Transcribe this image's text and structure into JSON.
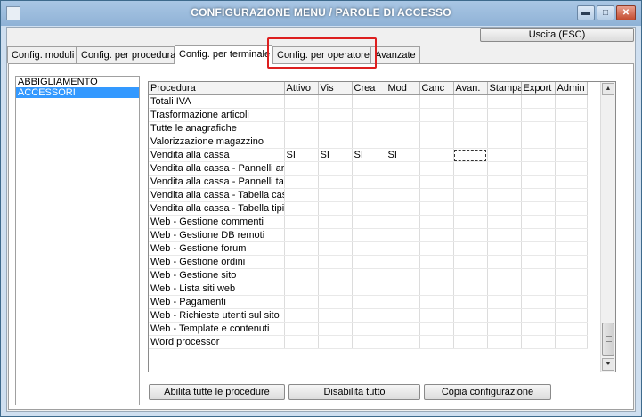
{
  "window": {
    "title": "CONFIGURAZIONE MENU / PAROLE DI ACCESSO",
    "minimize": "▬",
    "maximize": "□",
    "close": "✕"
  },
  "toolbar": {
    "exit_label": "Uscita (ESC)"
  },
  "tabs": [
    {
      "label": "Config. moduli"
    },
    {
      "label": "Config. per procedura"
    },
    {
      "label": "Config. per terminale"
    },
    {
      "label": "Config. per operatore"
    },
    {
      "label": "Avanzate"
    }
  ],
  "left_list": {
    "items": [
      "ABBIGLIAMENTO",
      "ACCESSORI"
    ],
    "selected_index": 1
  },
  "grid": {
    "columns": [
      "Procedura",
      "Attivo",
      "Vis",
      "Crea",
      "Mod",
      "Canc",
      "Avan.",
      "Stampa",
      "Export",
      "Admin"
    ],
    "rows": [
      [
        "Totali IVA",
        "",
        "",
        "",
        "",
        "",
        "",
        "",
        "",
        ""
      ],
      [
        "Trasformazione articoli",
        "",
        "",
        "",
        "",
        "",
        "",
        "",
        "",
        ""
      ],
      [
        "Tutte le anagrafiche",
        "",
        "",
        "",
        "",
        "",
        "",
        "",
        "",
        ""
      ],
      [
        "Valorizzazione magazzino",
        "",
        "",
        "",
        "",
        "",
        "",
        "",
        "",
        ""
      ],
      [
        "Vendita alla cassa",
        "SI",
        "SI",
        "SI",
        "SI",
        "",
        "",
        "",
        "",
        ""
      ],
      [
        "Vendita alla cassa - Pannelli artico",
        "",
        "",
        "",
        "",
        "",
        "",
        "",
        "",
        ""
      ],
      [
        "Vendita alla cassa - Pannelli tavol",
        "",
        "",
        "",
        "",
        "",
        "",
        "",
        "",
        ""
      ],
      [
        "Vendita alla cassa - Tabella casse",
        "",
        "",
        "",
        "",
        "",
        "",
        "",
        "",
        ""
      ],
      [
        "Vendita alla cassa - Tabella tipi di",
        "",
        "",
        "",
        "",
        "",
        "",
        "",
        "",
        ""
      ],
      [
        "Web - Gestione commenti",
        "",
        "",
        "",
        "",
        "",
        "",
        "",
        "",
        ""
      ],
      [
        "Web - Gestione DB remoti",
        "",
        "",
        "",
        "",
        "",
        "",
        "",
        "",
        ""
      ],
      [
        "Web - Gestione forum",
        "",
        "",
        "",
        "",
        "",
        "",
        "",
        "",
        ""
      ],
      [
        "Web - Gestione ordini",
        "",
        "",
        "",
        "",
        "",
        "",
        "",
        "",
        ""
      ],
      [
        "Web - Gestione sito",
        "",
        "",
        "",
        "",
        "",
        "",
        "",
        "",
        ""
      ],
      [
        "Web - Lista siti web",
        "",
        "",
        "",
        "",
        "",
        "",
        "",
        "",
        ""
      ],
      [
        "Web - Pagamenti",
        "",
        "",
        "",
        "",
        "",
        "",
        "",
        "",
        ""
      ],
      [
        "Web - Richieste utenti sul sito",
        "",
        "",
        "",
        "",
        "",
        "",
        "",
        "",
        ""
      ],
      [
        "Web - Template e contenuti",
        "",
        "",
        "",
        "",
        "",
        "",
        "",
        "",
        ""
      ],
      [
        "Word processor",
        "",
        "",
        "",
        "",
        "",
        "",
        "",
        "",
        ""
      ]
    ],
    "focused_cell": {
      "row": 4,
      "col": 6
    }
  },
  "scrollbar": {
    "up": "▲",
    "down": "▼"
  },
  "buttons": {
    "enable_all": "Abilita tutte le procedure",
    "disable_all": "Disabilita tutto",
    "copy_config": "Copia configurazione"
  },
  "colors": {
    "highlight_border": "#dd1f1f",
    "selection": "#3399ff"
  }
}
